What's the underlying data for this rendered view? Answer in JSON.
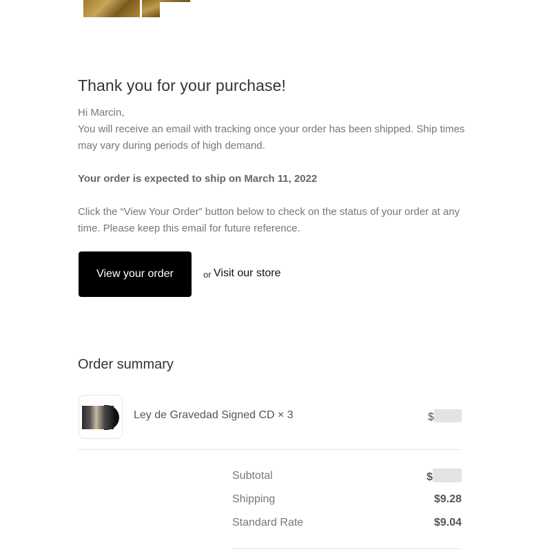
{
  "email": {
    "heading": "Thank you for your purchase!",
    "greeting": "Hi Marcin,",
    "tracking_text": "You will receive an email with tracking once your order has been shipped. Ship times may vary during periods of high demand.",
    "ship_notice": "Your order is expected to ship on March 11, 2022",
    "instructions": "Click the “View Your Order” button below to check on the status of your order at any time. Please keep this email for future reference.",
    "view_order_label": "View your order",
    "or_label": "or",
    "visit_store_label": "Visit our store"
  },
  "summary": {
    "title": "Order summary",
    "items": [
      {
        "name": "Ley de Gravedad Signed CD × 3",
        "price_prefix": "$"
      }
    ],
    "totals": {
      "subtotal_label": "Subtotal",
      "subtotal_prefix": "$",
      "shipping_label": "Shipping",
      "shipping_value": "$9.28",
      "standard_label": "Standard Rate",
      "standard_value": "$9.04"
    }
  }
}
